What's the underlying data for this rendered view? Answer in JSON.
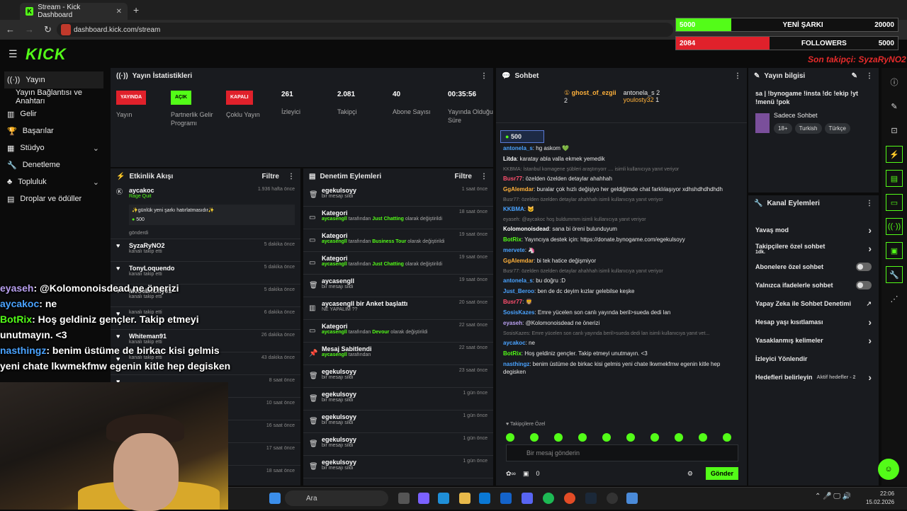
{
  "browser": {
    "tab_title": "Stream - Kick Dashboard",
    "url": "dashboard.kick.com/stream"
  },
  "overlay_bars": {
    "song": {
      "current": "5000",
      "label": "YENİ ŞARKI",
      "goal": "20000",
      "fill": 0.25
    },
    "followers": {
      "current": "2084",
      "label": "FOLLOWERS",
      "goal": "5000",
      "fill": 0.42
    },
    "last_follower": "Son takipçi: SyzaRyNO2"
  },
  "sidebar": {
    "items": [
      {
        "label": "Yayın",
        "icon": "stream-icon"
      },
      {
        "label": "Yayın Bağlantısı ve Anahtarı",
        "icon": ""
      },
      {
        "label": "Gelir",
        "icon": "revenue-icon"
      },
      {
        "label": "Başarılar",
        "icon": "trophy-icon"
      },
      {
        "label": "Stüdyo",
        "icon": "studio-icon"
      },
      {
        "label": "Denetleme",
        "icon": "wrench-icon"
      },
      {
        "label": "Topluluk",
        "icon": "community-icon"
      },
      {
        "label": "Droplar ve ödüller",
        "icon": "grid-icon"
      }
    ]
  },
  "stats": {
    "title": "Yayın İstatistikleri",
    "cols": [
      {
        "badge": "YAYINDA",
        "label": "Yayın",
        "badge_color": "#e0212b"
      },
      {
        "badge": "AÇIK",
        "label": "Partnerlik Gelir Programı",
        "badge_color": "#53fc18"
      },
      {
        "badge": "KAPALI",
        "label": "Çoklu Yayın",
        "badge_color": "#e0212b"
      },
      {
        "value": "261",
        "label": "İzleyici"
      },
      {
        "value": "2.081",
        "label": "Takipçi"
      },
      {
        "value": "40",
        "label": "Abone Sayısı"
      },
      {
        "value": "00:35:56",
        "label": "Yayında Olduğu Süre"
      }
    ]
  },
  "activity": {
    "title": "Etkinlik Akışı",
    "filter": "Filtre",
    "items": [
      {
        "name": "aycakoc",
        "sub": "Rage Quit",
        "time": "1.936 hafta önce",
        "gift": "✨günlük yeni şarkı hatırlatmasıdır✨",
        "amount": "500",
        "foot": "gönderdi"
      },
      {
        "name": "SyzaRyNO2",
        "sub": "kanalı takip etti",
        "time": "5 dakika önce"
      },
      {
        "name": "TonyLoquendo",
        "sub": "kanalı takip etti",
        "time": "5 dakika önce"
      },
      {
        "name": "MedelinCity01",
        "sub": "kanalı takip etti",
        "time": "5 dakika önce"
      },
      {
        "name": "",
        "sub": "kanalı takip etti",
        "time": "6 dakika önce"
      },
      {
        "name": "Whiteman91",
        "sub": "kanalı takip etti",
        "time": "26 dakika önce"
      },
      {
        "name": "",
        "sub": "kanalı takip etti",
        "time": "43 dakika önce"
      },
      {
        "name": "",
        "sub": "",
        "time": "8 saat önce"
      },
      {
        "name": "",
        "sub": "",
        "time": "10 saat önce"
      },
      {
        "name": "",
        "sub": "",
        "time": "16 saat önce"
      },
      {
        "name": "",
        "sub": "",
        "time": "17 saat önce"
      },
      {
        "name": "",
        "sub": "",
        "time": "18 saat önce"
      }
    ]
  },
  "modlog": {
    "title": "Denetim Eylemleri",
    "filter": "Filtre",
    "items": [
      {
        "title": "egekulsoyy",
        "desc": "bir mesajı sildi",
        "time": "1 saat önce",
        "icon": "trash-icon"
      },
      {
        "title": "Kategori",
        "desc_user": "aycasengll",
        "desc": " tarafından ",
        "desc_cat": "Just Chatting",
        "desc_end": " olarak değiştirildi",
        "time": "18 saat önce",
        "icon": "category-icon"
      },
      {
        "title": "Kategori",
        "desc_user": "aycasengll",
        "desc": " tarafından ",
        "desc_cat": "Business Tour",
        "desc_end": " olarak değiştirildi",
        "time": "19 saat önce",
        "icon": "category-icon"
      },
      {
        "title": "Kategori",
        "desc_user": "aycasengll",
        "desc": " tarafından ",
        "desc_cat": "Just Chatting",
        "desc_end": " olarak değiştirildi",
        "time": "19 saat önce",
        "icon": "category-icon"
      },
      {
        "title": "aycasengll",
        "desc": "bir mesajı sildi",
        "time": "19 saat önce",
        "icon": "trash-icon"
      },
      {
        "title": "aycasengll bir Anket başlattı",
        "desc": "NE YAPALIM ??",
        "time": "20 saat önce",
        "icon": "poll-icon"
      },
      {
        "title": "Kategori",
        "desc_user": "aycasengll",
        "desc": " tarafından ",
        "desc_cat": "Devour",
        "desc_end": " olarak değiştirildi",
        "time": "22 saat önce",
        "icon": "category-icon"
      },
      {
        "title": "Mesaj Sabitlendi",
        "desc_user": "aycasengll",
        "desc": " tarafından",
        "time": "22 saat önce",
        "icon": "pin-icon"
      },
      {
        "title": "egekulsoyy",
        "desc": "bir mesajı sildi",
        "time": "23 saat önce",
        "icon": "trash-icon"
      },
      {
        "title": "egekulsoyy",
        "desc": "bir mesajı sildi",
        "time": "1 gün önce",
        "icon": "trash-icon"
      },
      {
        "title": "egekulsoyy",
        "desc": "bir mesajı sildi",
        "time": "1 gün önce",
        "icon": "trash-icon"
      },
      {
        "title": "egekulsoyy",
        "desc": "bir mesajı sildi",
        "time": "1 gün önce",
        "icon": "trash-icon"
      },
      {
        "title": "egekulsoyy",
        "desc": "bir mesajı sildi",
        "time": "1 gün önce",
        "icon": "trash-icon"
      }
    ]
  },
  "chat": {
    "title": "Sohbet",
    "top": [
      {
        "name": "ghost_of_ezgii",
        "count": "2"
      },
      {
        "name": "antonela_s",
        "count": "2"
      },
      {
        "name": "youlosty32",
        "count": "1"
      }
    ],
    "gift_amount": "500",
    "messages": [
      {
        "user": "antonela_s",
        "text": ": hg askom 💚",
        "color": "#4aa3ff"
      },
      {
        "user": "Litda",
        "text": ": karatay abla valla ekmek yemedik",
        "color": "#ffffff"
      },
      {
        "reply": "KKBMA: İstanbul komagene şübleri araştırıyorr .... isimli kullanıcıya yanıt veriyor"
      },
      {
        "user": "Busr77",
        "text": ": özelden özelden detaylar ahahhah",
        "color": "#ff4f6e"
      },
      {
        "user": "GgAlemdar",
        "text": ": buralar çok hızlı değişiyo her geldiğimde chat farklılaşıyor xdhshdhdhdhdh",
        "color": "#ffb13b"
      },
      {
        "reply": "Busr77: özelden özelden detaylar ahahhah isimli kullanıcıya yanıt veriyor"
      },
      {
        "user": "KKBMA",
        "text": ": 🐱",
        "color": "#4aa3ff"
      },
      {
        "reply": "eyaseh: @aycakoc hoş buldummm isimli kullanıcıya yanıt veriyor"
      },
      {
        "user": "Kolomonoisdead",
        "text": ": sana bi öreni bulunduyum",
        "color": "#ffffff"
      },
      {
        "user": "BotRix",
        "text": ": Yayıncıya destek için: https://donate.bynogame.com/egekulsoyy",
        "color": "#53fc18"
      },
      {
        "user": "mervete",
        "text": ": 🦄",
        "color": "#4aa3ff"
      },
      {
        "user": "GgAlemdar",
        "text": ": bi tek hatice değişmiyor",
        "color": "#ffb13b"
      },
      {
        "reply": "Busr77: özelden özelden detaylar ahahhah isimli kullanıcıya yanıt veriyor"
      },
      {
        "user": "antonela_s",
        "text": ": bu doğru :D",
        "color": "#4aa3ff"
      },
      {
        "user": "Just_Beroo",
        "text": ": ben de dc deyim kızlar gelebilse keşke",
        "color": "#4aa3ff"
      },
      {
        "user": "Busr77",
        "text": ": 🦁",
        "color": "#ff4f6e"
      },
      {
        "user": "SosisKazes",
        "text": ": Emre yücelen son canlı yayında beril>sueda dedi lan",
        "color": "#4aa3ff"
      },
      {
        "user": "eyaseh",
        "text": ": @Kolomonoisdead ne önerizi",
        "color": "#b9a0f0"
      },
      {
        "reply": "SosisKazes: Emre yücelen son canlı yayında beril>sueda dedi lan isimli kullanıcıya yanıt vet..."
      },
      {
        "user": "aycakoc",
        "text": ": ne",
        "color": "#4aa3ff"
      },
      {
        "user": "BotRix",
        "text": ": Hoş geldiniz gençler. Takip etmeyi unutmayın. <3",
        "color": "#53fc18"
      },
      {
        "user": "nasthingz",
        "text": ": benim üstüme de birkac kisi gelmis yeni chate lkwmekfmw egenin kitle hep degisken",
        "color": "#4aa3ff"
      }
    ],
    "subs_only": "Takipçilere Özel",
    "input_placeholder": "Bir mesaj gönderin",
    "foot_count": "0",
    "send": "Gönder"
  },
  "info": {
    "title": "Yayın bilgisi",
    "stream_title": "sa | !bynogame !insta !dc !ekip !yt !menü !pok",
    "category": "Sadece Sohbet",
    "tags": [
      "18+",
      "Turkish",
      "Türkçe"
    ]
  },
  "actions": {
    "title": "Kanal Eylemleri",
    "items": [
      {
        "label": "Yavaş mod",
        "kind": "arrow"
      },
      {
        "label": "Takipçilere özel sohbet",
        "sub": "1dk.",
        "kind": "arrow"
      },
      {
        "label": "Abonelere özel sohbet",
        "kind": "toggle"
      },
      {
        "label": "Yalnızca ifadelerle sohbet",
        "kind": "toggle"
      },
      {
        "label": "Yapay Zeka ile Sohbet Denetimi",
        "kind": "ext"
      },
      {
        "label": "Hesap yaşı kısıtlaması",
        "kind": "arrow"
      },
      {
        "label": "Yasaklanmış kelimeler",
        "kind": "arrow"
      },
      {
        "label": "İzleyici Yönlendir",
        "kind": "none"
      },
      {
        "label": "Hedefleri belirleyin",
        "sub": "Aktif hedefler - 2",
        "kind": "arrow"
      }
    ]
  },
  "stream_overlay": [
    {
      "user": "eyaseh",
      "text": ": @Kolomonoisdead ne önerizi"
    },
    {
      "user": "aycakoc",
      "text": ": ne"
    },
    {
      "user": "BotRix",
      "text": ": Hoş geldiniz gençler. Takip etmeyi unutmayın. <3"
    },
    {
      "user": "nasthingz",
      "text": ": benim üstüme de birkac kisi gelmis yeni chate lkwmekfmw egenin kitle hep degisken"
    }
  ],
  "taskbar": {
    "search": "Ara",
    "time": "22:06",
    "date": "15.02.2026"
  },
  "colors": {
    "kick_green": "#53fc18",
    "panel": "#191b1f",
    "bg": "#0b0b0b"
  }
}
